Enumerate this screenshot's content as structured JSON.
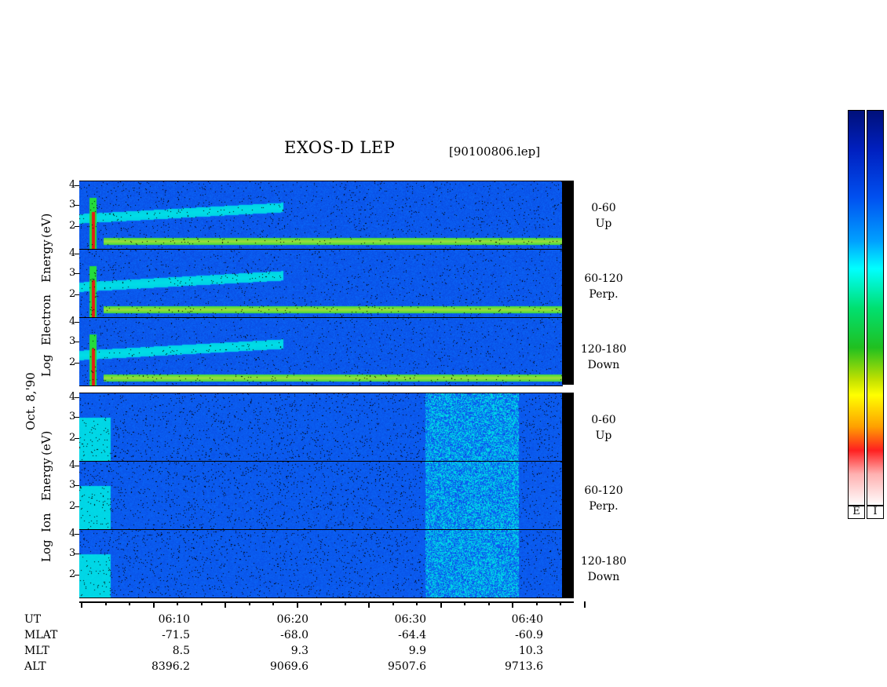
{
  "title": "EXOS-D LEP",
  "file_id": "[90100806.lep]",
  "date_label": "Oct. 8,'90",
  "ylabels": {
    "electron_left": "Electron",
    "electron_energy": "Energy",
    "electron_ev": "(eV)",
    "electron_log": "Log",
    "ion_energy": "Energy",
    "ion_ev": "(eV)",
    "ion_left": "Ion",
    "ion_log": "Log"
  },
  "ytick_labels": [
    "4",
    "3",
    "2"
  ],
  "channels": [
    {
      "angle": "0-60",
      "dir": "Up"
    },
    {
      "angle": "60-120",
      "dir": "Perp."
    },
    {
      "angle": "120-180",
      "dir": "Down"
    },
    {
      "angle": "0-60",
      "dir": "Up"
    },
    {
      "angle": "60-120",
      "dir": "Perp."
    },
    {
      "angle": "120-180",
      "dir": "Down"
    }
  ],
  "table": {
    "rows": [
      "UT",
      "MLAT",
      "MLT",
      "ALT"
    ],
    "columns": [
      {
        "UT": "06:10",
        "MLAT": "-71.5",
        "MLT": "8.5",
        "ALT": "8396.2"
      },
      {
        "UT": "06:20",
        "MLAT": "-68.0",
        "MLT": "9.3",
        "ALT": "9069.6"
      },
      {
        "UT": "06:30",
        "MLAT": "-64.4",
        "MLT": "9.9",
        "ALT": "9507.6"
      },
      {
        "UT": "06:40",
        "MLAT": "-60.9",
        "MLT": "10.3",
        "ALT": "9713.6"
      }
    ]
  },
  "colorbar_labels": [
    "E",
    "I"
  ],
  "colors": {
    "background_blue": "#1030d0",
    "band_yellow": "#f0e020",
    "band_green": "#20d060",
    "spike_red": "#e01010"
  },
  "chart_data": {
    "type": "heatmap",
    "title": "EXOS-D LEP",
    "xlabel": "UT",
    "ylabel": "Log Energy (eV)",
    "x_ticks": [
      "06:10",
      "06:20",
      "06:30",
      "06:40"
    ],
    "y_ticks": [
      4,
      3,
      2
    ],
    "ylim": [
      1,
      4.2
    ],
    "panels": [
      {
        "species": "Electron",
        "pitch_angle": "0-60",
        "direction": "Up"
      },
      {
        "species": "Electron",
        "pitch_angle": "60-120",
        "direction": "Perp."
      },
      {
        "species": "Electron",
        "pitch_angle": "120-180",
        "direction": "Down"
      },
      {
        "species": "Ion",
        "pitch_angle": "0-60",
        "direction": "Up"
      },
      {
        "species": "Ion",
        "pitch_angle": "60-120",
        "direction": "Perp."
      },
      {
        "species": "Ion",
        "pitch_angle": "120-180",
        "direction": "Down"
      }
    ],
    "colorbar": [
      "E",
      "I"
    ]
  }
}
